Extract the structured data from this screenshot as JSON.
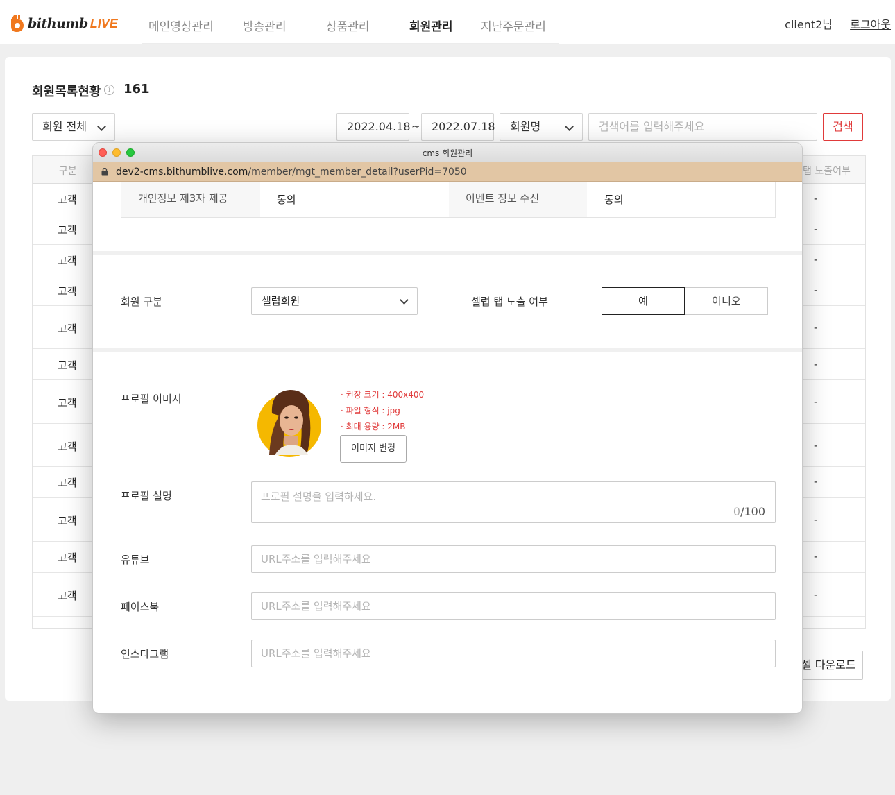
{
  "header": {
    "logo_text": "bithumb",
    "logo_live": "LIVE",
    "nav": [
      "메인영상관리",
      "방송관리",
      "상품관리",
      "회원관리",
      "지난주문관리"
    ],
    "active_nav": "회원관리",
    "user": "client2님",
    "logout": "로그아웃"
  },
  "list": {
    "title": "회원목록현황",
    "info_icon": "i",
    "count": "161",
    "filter": "회원 전체",
    "date_from": "2022.04.18",
    "date_sep": "~",
    "date_to": "2022.07.18",
    "search_type": "회원명",
    "search_placeholder": "검색어를 입력해주세요",
    "search_btn": "검색",
    "col_kind": "구분",
    "col_exposure": "탭 노출여부",
    "rows": [
      {
        "kind": "고객",
        "exposure": "-"
      },
      {
        "kind": "고객",
        "exposure": "-"
      },
      {
        "kind": "고객",
        "exposure": "-"
      },
      {
        "kind": "고객",
        "exposure": "-"
      },
      {
        "kind": "고객",
        "exposure": "-"
      },
      {
        "kind": "고객",
        "exposure": "-"
      },
      {
        "kind": "고객",
        "exposure": "-"
      },
      {
        "kind": "고객",
        "exposure": "-"
      },
      {
        "kind": "고객",
        "exposure": "-"
      },
      {
        "kind": "고객",
        "exposure": "-"
      },
      {
        "kind": "고객",
        "exposure": "-"
      },
      {
        "kind": "고객",
        "exposure": "-"
      }
    ],
    "excel_btn": "셀 다운로드"
  },
  "popup": {
    "window_title": "cms 회원관리",
    "url_host": "dev2-cms.bithumblive.com",
    "url_path": "/member/mgt_member_detail?userPid=7050",
    "agree_3rd_label": "개인정보 제3자 제공",
    "agree_3rd_value": "동의",
    "event_label": "이벤트 정보 수신",
    "event_value": "동의",
    "member_type_label": "회원 구분",
    "member_type_value": "셀럽회원",
    "celeb_tab_label": "셀럽 탭 노출 여부",
    "yes": "예",
    "no": "아니오",
    "profile_image_label": "프로필 이미지",
    "hints": [
      "· 권장 크기 : 400x400",
      "· 파일 형식 : jpg",
      "· 최대 용량 : 2MB"
    ],
    "change_image": "이미지 변경",
    "profile_desc_label": "프로필 설명",
    "profile_desc_placeholder": "프로필 설명을 입력하세요.",
    "desc_count": "0",
    "desc_max": "/100",
    "youtube_label": "유튜브",
    "facebook_label": "페이스북",
    "instagram_label": "인스타그램",
    "url_placeholder": "URL주소를 입력해주세요"
  },
  "colors": {
    "accent_red": "#e03a3a",
    "brand_orange": "#f0781e",
    "urlbar": "#e2c6a4",
    "avatar_bg": "#f5b800"
  }
}
